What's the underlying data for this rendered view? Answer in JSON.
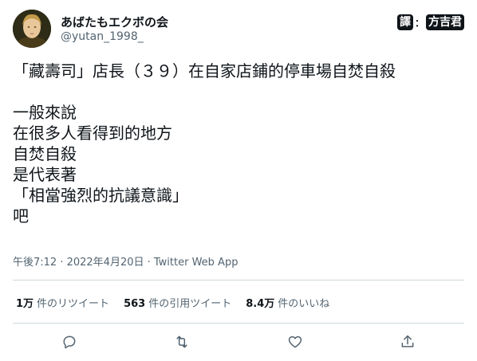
{
  "profile": {
    "display_name": "あばたもエクボの会",
    "handle": "@yutan_1998_"
  },
  "credit": {
    "label_left": "譯",
    "separator": "：",
    "label_right": "方吉君"
  },
  "tweet": {
    "text": "「藏壽司」店長（３９）在自家店鋪的停車場自焚自殺\n\n一般來說\n在很多人看得到的地方\n自焚自殺\n是代表著\n「相當強烈的抗議意識」\n吧"
  },
  "meta": {
    "timestamp": "午後7:12 · 2022年4月20日 · Twitter Web App"
  },
  "stats": [
    {
      "num": "1万",
      "label": "件のリツイート"
    },
    {
      "num": "563",
      "label": "件の引用ツイート"
    },
    {
      "num": "8.4万",
      "label": "件のいいね"
    }
  ],
  "actions": {
    "reply_icon": "reply-icon",
    "retweet_icon": "retweet-icon",
    "like_icon": "heart-icon",
    "share_icon": "share-icon"
  }
}
